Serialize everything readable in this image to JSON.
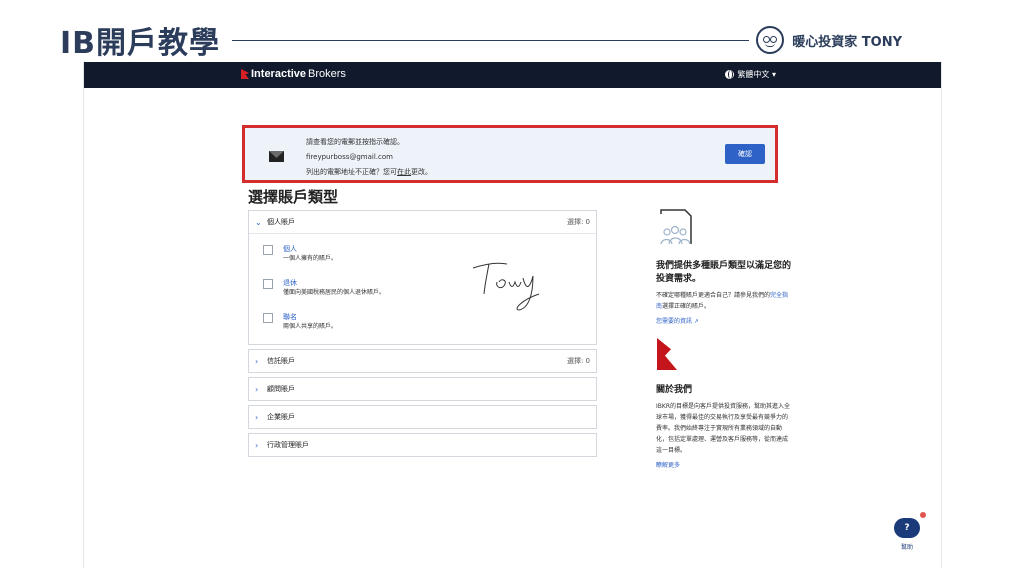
{
  "slide": {
    "title": "IB開戶教學",
    "brand_name": "暖心投資家 TONY"
  },
  "navbar": {
    "logo_bold": "Interactive",
    "logo_rest": "Brokers",
    "language": "繁體中文 ▾"
  },
  "notice": {
    "line1": "請查看您的電郵並按指示確認。",
    "email": "fireypurboss@gmail.com",
    "line3_prefix": "列出的電郵地址不正確？您可",
    "line3_link": "在此",
    "line3_suffix": "更改。",
    "confirm_label": "確認"
  },
  "section_title": "選擇賬戶類型",
  "accordion": {
    "individual": {
      "label": "個人賬戶",
      "count": "選擇: 0",
      "options": [
        {
          "title": "個人",
          "desc": "一個人擁有的賬戶。"
        },
        {
          "title": "退休",
          "desc": "僅面向美國稅務居民的個人退休賬戶。"
        },
        {
          "title": "聯名",
          "desc": "兩個人共享的賬戶。"
        }
      ]
    },
    "trust": {
      "label": "信託賬戶",
      "count": "選擇: 0"
    },
    "advisor": {
      "label": "顧問賬戶"
    },
    "corporate": {
      "label": "企業賬戶"
    },
    "admin": {
      "label": "行政管理賬戶"
    }
  },
  "side": {
    "title": "我們提供多種賬戶類型以滿足您的投資需求。",
    "text_prefix": "不確定哪種賬戶更適合自己？請參見我們的",
    "text_link": "完全指南",
    "text_suffix": "選擇正確的賬戶。",
    "link": "您需要的資訊 ↗",
    "about_title": "關於我們",
    "about_text": "IBKR的目標是向客戶提供投資服務，幫助其進入全球市場，獲得最佳的交易執行及享受最有競爭力的費率。我們始終專注于實現所有業務領域的自動化，包括定單處理、運營及客戶服務等，從而達成這一目標。",
    "about_link": "瞭解更多"
  },
  "help": {
    "icon": "?",
    "label": "幫助"
  }
}
